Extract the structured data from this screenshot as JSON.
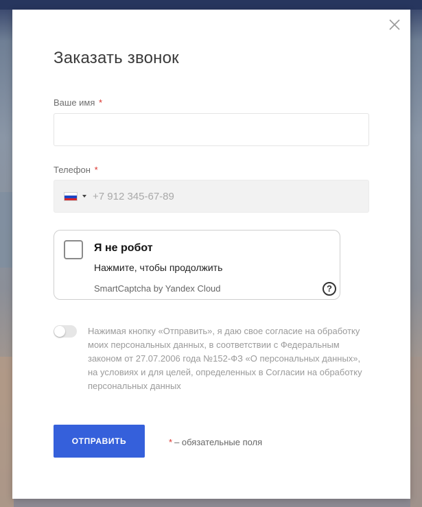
{
  "modal": {
    "title": "Заказать звонок",
    "close_icon": "close-icon"
  },
  "form": {
    "name_label": "Ваше имя",
    "name_value": "",
    "phone_label": "Телефон",
    "phone_placeholder": "+7 912 345-67-89",
    "phone_country": "RU",
    "required_mark": "*"
  },
  "captcha": {
    "title": "Я не робот",
    "subtitle": "Нажмите, чтобы продолжить",
    "brand": "SmartCaptcha by Yandex Cloud",
    "help_icon": "?"
  },
  "consent": {
    "enabled": false,
    "text": "Нажимая кнопку «Отправить», я даю свое согласие на обработку моих персональных данных, в соответствии с Федеральным законом от 27.07.2006 года №152-ФЗ «О персональных данных», на условиях и для целей, определенных в Согласии на обработку персональных данных"
  },
  "actions": {
    "submit_label": "ОТПРАВИТЬ",
    "required_note": "– обязательные поля"
  },
  "colors": {
    "accent": "#3560db",
    "required": "#d9302a"
  }
}
